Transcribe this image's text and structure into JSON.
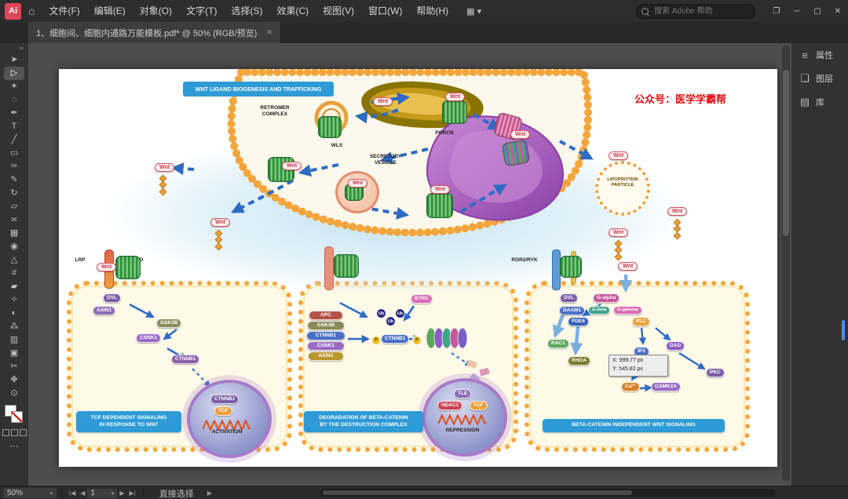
{
  "menubar": {
    "logo": "Ai",
    "home_icon": "⌂",
    "items": [
      "文件(F)",
      "编辑(E)",
      "对象(O)",
      "文字(T)",
      "选择(S)",
      "效果(C)",
      "视图(V)",
      "窗口(W)",
      "帮助(H)"
    ],
    "layout_icon": "▦",
    "layout_caret": "▾",
    "search_placeholder": "搜索 Adobe 帮助",
    "win_layout_icon": "❐",
    "minimize": "─",
    "maximize": "▢",
    "close": "✕"
  },
  "tabbar": {
    "title": "1、细胞间、细胞内通路万能模板.pdf* @ 50% (RGB/预览)",
    "close": "✕"
  },
  "toolbar": {
    "collapse": "»",
    "more": "⋯",
    "tools": [
      {
        "name": "selection",
        "glyph": "➤"
      },
      {
        "name": "direct-selection",
        "glyph": "▷"
      },
      {
        "name": "magic-wand",
        "glyph": "✶"
      },
      {
        "name": "lasso",
        "glyph": "◌"
      },
      {
        "name": "pen",
        "glyph": "✒"
      },
      {
        "name": "type",
        "glyph": "T"
      },
      {
        "name": "line-segment",
        "glyph": "╱"
      },
      {
        "name": "rectangle",
        "glyph": "▭"
      },
      {
        "name": "paintbrush",
        "glyph": "✑"
      },
      {
        "name": "pencil",
        "glyph": "✎"
      },
      {
        "name": "rotate",
        "glyph": "↻"
      },
      {
        "name": "scale",
        "glyph": "▱"
      },
      {
        "name": "width",
        "glyph": "≍"
      },
      {
        "name": "free-transform",
        "glyph": "▦"
      },
      {
        "name": "shape-builder",
        "glyph": "◉"
      },
      {
        "name": "perspective-grid",
        "glyph": "△"
      },
      {
        "name": "mesh",
        "glyph": "#"
      },
      {
        "name": "gradient",
        "glyph": "▰"
      },
      {
        "name": "eyedropper",
        "glyph": "✧"
      },
      {
        "name": "blend",
        "glyph": "◐"
      },
      {
        "name": "symbol-sprayer",
        "glyph": "⁂"
      },
      {
        "name": "column-graph",
        "glyph": "▥"
      },
      {
        "name": "artboard",
        "glyph": "▣"
      },
      {
        "name": "slice",
        "glyph": "✂"
      },
      {
        "name": "hand",
        "glyph": "✥"
      },
      {
        "name": "zoom",
        "glyph": "⊙"
      }
    ]
  },
  "rightpanel": {
    "items": [
      {
        "icon": "≡",
        "label": "属性"
      },
      {
        "icon": "❏",
        "label": "图层"
      },
      {
        "icon": "▤",
        "label": "库"
      }
    ]
  },
  "statusbar": {
    "zoom": "50%",
    "caret": "▾",
    "nav_first": "|◀",
    "nav_prev": "◀",
    "page": "1",
    "nav_next": "▶",
    "nav_last": "▶|",
    "tool": "直接选择",
    "scroll_arrow": "▶"
  },
  "colors": {
    "accent_blue": "#2E9BD6",
    "wnt_red": "#D4505E"
  },
  "diagram": {
    "title": "WNT LIGAND BIOGENESIS AND TRAFFICKING",
    "watermark": "公众号：医学学霸帮",
    "wnt": "Wnt",
    "retromer_1": "RETROMER",
    "retromer_2": "COMPLEX",
    "wls": "WLS",
    "porcn": "PORCN",
    "secretory_1": "SECRETORY",
    "secretory_2": "VESICLE",
    "lipoprotein_1": "LIPOPROTEIN",
    "lipoprotein_2": "PARTICLE",
    "lrp": "LRP",
    "fzd": "FZD",
    "ror2ryk": "ROR2/RYK",
    "dvl": "DVL",
    "axin1": "AXIN1",
    "gsk3b": "GSK3B",
    "csnk1": "CSNK1",
    "ctnnb1": "CTNNB1",
    "tcf": "TCF",
    "apc": "APC",
    "btrc": "BTRC",
    "ub": "Ub",
    "p": "P",
    "tle": "TLE",
    "hdac1": "HDAC1",
    "galpha": "G-alpha",
    "gbeta": "G-beta",
    "ggamma": "G-gamma",
    "daam1": "DAAM1",
    "pde6": "PDE6",
    "plc": "PLC",
    "rac1": "RAC1",
    "rhoa": "RHOA",
    "ip3": "IP3",
    "dag": "DAG",
    "pkc": "PKC",
    "camk2a": "CAMK2A",
    "ca": "Ca²⁺",
    "activation": "ACTIVATION",
    "repression": "REPRESSION",
    "panel1_label_1": "TCF DEPENDENT SIGNALING",
    "panel1_label_2": "IN RESPONSE TO WNT",
    "panel2_label_1": "DEGRADATION OF BETA-CATENIN",
    "panel2_label_2": "BY THE DESTRUCTION COMPLEX",
    "panel3_label": "BETA-CATENIN INDEPENDENT WNT SIGNALING",
    "tooltip_x": "X: 999.77 px",
    "tooltip_y": "Y: 545.82 px"
  }
}
